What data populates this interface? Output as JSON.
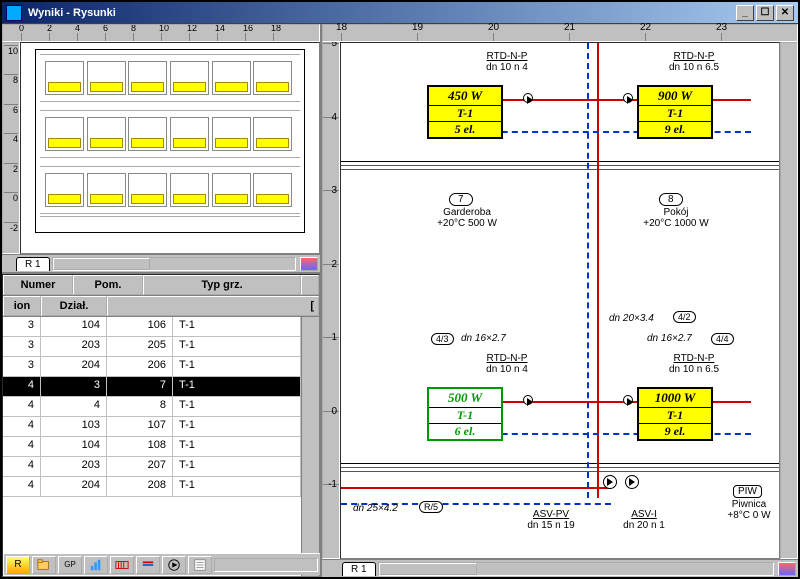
{
  "window": {
    "title": "Wyniki - Rysunki"
  },
  "overview": {
    "ruler_top_start": "14",
    "ruler_top": [
      "0",
      "2",
      "4",
      "6",
      "8",
      "10",
      "12",
      "14",
      "16",
      "18"
    ],
    "ruler_left": [
      "10",
      "8",
      "6",
      "4",
      "2",
      "0",
      "-2"
    ],
    "tab": "R 1"
  },
  "table": {
    "head1": {
      "c1": "Numer",
      "c2": "Pom.",
      "c3": "Typ grz."
    },
    "head2": {
      "cA": "ion",
      "cB": "Dział.",
      "cC": "["
    },
    "rows": [
      {
        "a": "3",
        "b": "104",
        "c": "106",
        "d": "T-1",
        "sel": false
      },
      {
        "a": "3",
        "b": "203",
        "c": "205",
        "d": "T-1",
        "sel": false
      },
      {
        "a": "3",
        "b": "204",
        "c": "206",
        "d": "T-1",
        "sel": false
      },
      {
        "a": "4",
        "b": "3",
        "c": "7",
        "d": "T-1",
        "sel": true
      },
      {
        "a": "4",
        "b": "4",
        "c": "8",
        "d": "T-1",
        "sel": false
      },
      {
        "a": "4",
        "b": "103",
        "c": "107",
        "d": "T-1",
        "sel": false
      },
      {
        "a": "4",
        "b": "104",
        "c": "108",
        "d": "T-1",
        "sel": false
      },
      {
        "a": "4",
        "b": "203",
        "c": "207",
        "d": "T-1",
        "sel": false
      },
      {
        "a": "4",
        "b": "204",
        "c": "208",
        "d": "T-1",
        "sel": false
      }
    ]
  },
  "drawing": {
    "ruler_top_start": "76",
    "ruler_top": [
      "18",
      "19",
      "20",
      "21",
      "22",
      "23"
    ],
    "ruler_left": [
      "5",
      "4",
      "3",
      "2",
      "1",
      "0",
      "-1"
    ],
    "tab": "R 1",
    "rooms": [
      {
        "num": "7",
        "name": "Garderoba",
        "cond": "+20°C 500 W"
      },
      {
        "num": "8",
        "name": "Pokój",
        "cond": "+20°C 1000 W"
      }
    ],
    "radiators": [
      {
        "id": "rA",
        "w": "450 W",
        "t": "T-1",
        "e": "5 el."
      },
      {
        "id": "rB",
        "w": "900 W",
        "t": "T-1",
        "e": "9 el."
      },
      {
        "id": "rC",
        "w": "500 W",
        "t": "T-1",
        "e": "6 el.",
        "green": true
      },
      {
        "id": "rD",
        "w": "1000 W",
        "t": "T-1",
        "e": "9 el."
      }
    ],
    "pipe_labels": {
      "rtdA": "RTD-N-P",
      "dnA": "dn 10  n 4",
      "rtdB": "RTD-N-P",
      "dnB": "dn 10  n 6.5",
      "seg_top": "dn 20×3.4",
      "node_top": "4/2",
      "node_l": "4/3",
      "seg_l": "dn 16×2.7",
      "node_r": "4/4",
      "seg_r": "dn 16×2.7",
      "rtdC": "RTD-N-P",
      "dnC": "dn 10  n 4",
      "rtdD": "RTD-N-P",
      "dnD": "dn 10  n 6.5",
      "bot_seg": "dn 25×4.2",
      "bot_node": "R/5",
      "asv_pv": "ASV-PV",
      "asv_pv_dn": "dn 15  n 19",
      "asv_i": "ASV-I",
      "asv_i_dn": "dn 20  n 1"
    },
    "basement": {
      "tag": "PIW",
      "name": "Piwnica",
      "cond": "+8°C 0 W"
    }
  }
}
